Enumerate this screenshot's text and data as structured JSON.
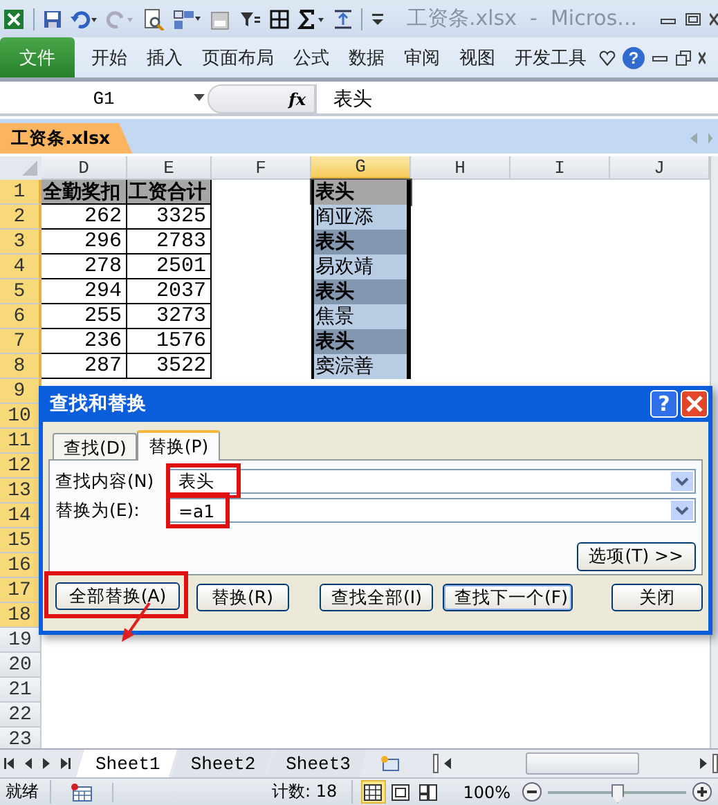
{
  "title_bar": {
    "title": "工资条.xlsx  -  Micros..."
  },
  "ribbon": {
    "tabs": [
      {
        "label": "文件",
        "kind": "file",
        "selected": false
      },
      {
        "label": "开始",
        "kind": "tab",
        "selected": false
      },
      {
        "label": "插入",
        "kind": "tab",
        "selected": false
      },
      {
        "label": "页面布局",
        "kind": "tab",
        "selected": false
      },
      {
        "label": "公式",
        "kind": "tab",
        "selected": false
      },
      {
        "label": "数据",
        "kind": "tab",
        "selected": false
      },
      {
        "label": "审阅",
        "kind": "tab",
        "selected": false
      },
      {
        "label": "视图",
        "kind": "tab",
        "selected": false
      },
      {
        "label": "开发工具",
        "kind": "tab",
        "selected": false
      }
    ],
    "help": "?"
  },
  "formula_bar": {
    "name_box": "G1",
    "function_label": "fx",
    "value": "表头"
  },
  "workbook_tab": {
    "label": "工资条.xlsx"
  },
  "sheet": {
    "columns": [
      {
        "label": "D",
        "selected": false
      },
      {
        "label": "E",
        "selected": false
      },
      {
        "label": "F",
        "selected": false
      },
      {
        "label": "G",
        "selected": true
      },
      {
        "label": "H",
        "selected": false
      },
      {
        "label": "I",
        "selected": false
      },
      {
        "label": "J",
        "selected": false
      }
    ],
    "rows": [
      {
        "label": "1",
        "selected": true,
        "kind": "header",
        "D": "全勤奖扣",
        "E": "工资合计",
        "G": {
          "text": "表头",
          "kind": "header",
          "active": true
        }
      },
      {
        "label": "2",
        "selected": true,
        "kind": "data",
        "D": "262",
        "E": "3325",
        "G": {
          "text": "阎亚添",
          "kind": "name",
          "active": false
        }
      },
      {
        "label": "3",
        "selected": true,
        "kind": "data",
        "D": "296",
        "E": "2783",
        "G": {
          "text": "表头",
          "kind": "header",
          "active": false
        }
      },
      {
        "label": "4",
        "selected": true,
        "kind": "data",
        "D": "278",
        "E": "2501",
        "G": {
          "text": "易欢靖",
          "kind": "name",
          "active": false
        }
      },
      {
        "label": "5",
        "selected": true,
        "kind": "data",
        "D": "294",
        "E": "2037",
        "G": {
          "text": "表头",
          "kind": "header",
          "active": false
        }
      },
      {
        "label": "6",
        "selected": true,
        "kind": "data",
        "D": "255",
        "E": "3273",
        "G": {
          "text": "焦景",
          "kind": "name",
          "active": false
        }
      },
      {
        "label": "7",
        "selected": true,
        "kind": "data",
        "D": "236",
        "E": "1576",
        "G": {
          "text": "表头",
          "kind": "header",
          "active": false
        }
      },
      {
        "label": "8",
        "selected": true,
        "kind": "data",
        "D": "287",
        "E": "3522",
        "G": {
          "text": "窦淙善",
          "kind": "name",
          "active": false
        }
      },
      {
        "label": "9",
        "selected": true
      },
      {
        "label": "10",
        "selected": true
      },
      {
        "label": "11",
        "selected": true
      },
      {
        "label": "12",
        "selected": true
      },
      {
        "label": "13",
        "selected": true
      },
      {
        "label": "14",
        "selected": true
      },
      {
        "label": "15",
        "selected": true
      },
      {
        "label": "16",
        "selected": true
      },
      {
        "label": "17",
        "selected": true
      },
      {
        "label": "18",
        "selected": true
      },
      {
        "label": "19",
        "selected": false
      },
      {
        "label": "20",
        "selected": false
      },
      {
        "label": "21",
        "selected": false
      },
      {
        "label": "22",
        "selected": false
      },
      {
        "label": "23",
        "selected": false
      }
    ]
  },
  "dialog": {
    "title": "查找和替换",
    "help": "?",
    "tabs": [
      {
        "label": "查找(D)",
        "selected": false
      },
      {
        "label": "替换(P)",
        "selected": true
      }
    ],
    "find": {
      "label": "查找内容(N)",
      "value": "表头",
      "highlighted": true
    },
    "replace": {
      "label": "替换为(E):",
      "value": "=a1",
      "highlighted": true
    },
    "options_button": "选项(T) >>",
    "buttons": [
      {
        "label": "全部替换(A)",
        "highlighted": true,
        "default": false
      },
      {
        "label": "替换(R)",
        "highlighted": false,
        "default": false
      },
      {
        "label": "查找全部(I)",
        "highlighted": false,
        "default": false
      },
      {
        "label": "查找下一个(F)",
        "highlighted": false,
        "default": true
      },
      {
        "label": "关闭",
        "highlighted": false,
        "default": false
      }
    ]
  },
  "sheet_tabs": [
    {
      "label": "Sheet1",
      "selected": true
    },
    {
      "label": "Sheet2",
      "selected": false
    },
    {
      "label": "Sheet3",
      "selected": false
    }
  ],
  "status_bar": {
    "status": "就绪",
    "count": "计数: 18",
    "views": [
      {
        "kind": "normal",
        "selected": true
      },
      {
        "kind": "page_layout",
        "selected": false
      },
      {
        "kind": "page_break",
        "selected": false
      }
    ],
    "zoom": "100%",
    "zoom_slider": {
      "level": 0.5
    }
  }
}
